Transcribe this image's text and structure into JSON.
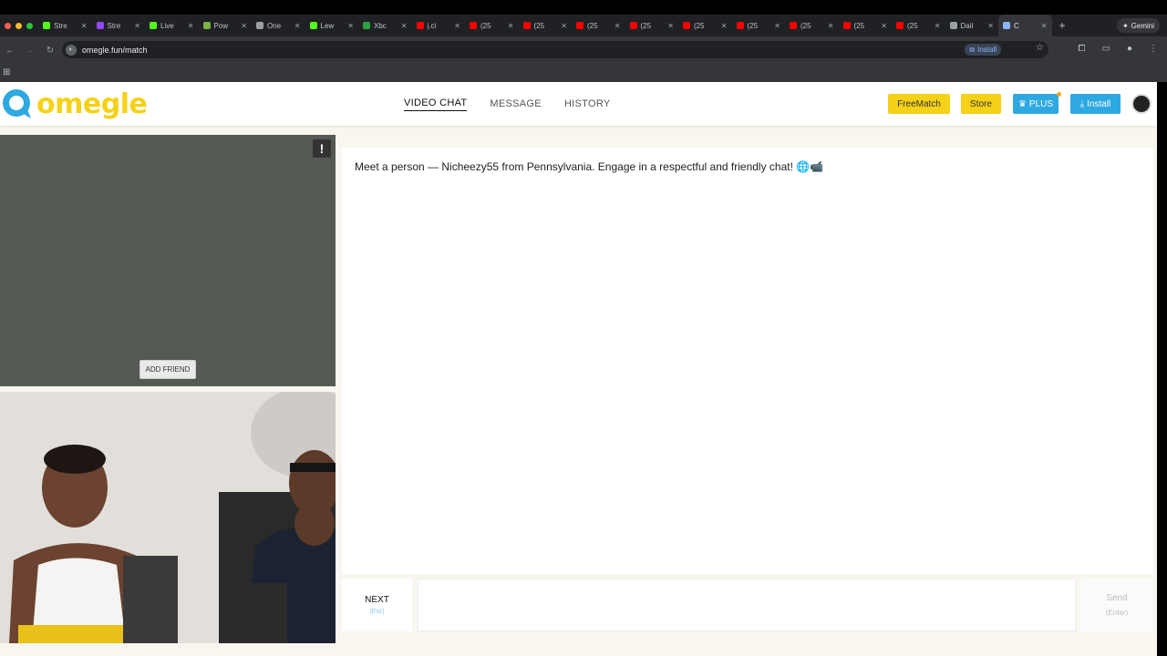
{
  "browser": {
    "tabs": [
      {
        "label": "Stre",
        "icon": "kick-icon",
        "color": "#53fc18"
      },
      {
        "label": "Stre",
        "icon": "twitch-icon",
        "color": "#9146ff"
      },
      {
        "label": "Live",
        "icon": "play-icon",
        "color": "#53fc18"
      },
      {
        "label": "Pow",
        "icon": "leaf-icon",
        "color": "#7cb342"
      },
      {
        "label": "One",
        "icon": "globe-icon",
        "color": "#9aa0a6"
      },
      {
        "label": "Lew",
        "icon": "play-icon",
        "color": "#53fc18"
      },
      {
        "label": "Xbc",
        "icon": "xbox-icon",
        "color": "#2ca243"
      },
      {
        "label": "j.ci",
        "icon": "youtube-icon",
        "color": "#ff0000"
      },
      {
        "label": "(25",
        "icon": "youtube-icon",
        "color": "#ff0000"
      },
      {
        "label": "(25",
        "icon": "youtube-icon",
        "color": "#ff0000"
      },
      {
        "label": "(25",
        "icon": "youtube-icon",
        "color": "#ff0000"
      },
      {
        "label": "(25",
        "icon": "youtube-icon",
        "color": "#ff0000"
      },
      {
        "label": "(25",
        "icon": "youtube-icon",
        "color": "#ff0000"
      },
      {
        "label": "(25",
        "icon": "youtube-icon",
        "color": "#ff0000"
      },
      {
        "label": "(25",
        "icon": "youtube-icon",
        "color": "#ff0000"
      },
      {
        "label": "(25",
        "icon": "youtube-icon",
        "color": "#ff0000"
      },
      {
        "label": "(25",
        "icon": "youtube-icon",
        "color": "#ff0000"
      },
      {
        "label": "Dail",
        "icon": "x-icon",
        "color": "#9aa0a6"
      },
      {
        "label": "C",
        "icon": "omegle-icon",
        "color": "#8ab4f8",
        "active": true
      }
    ],
    "new_tab": "+",
    "gemini_label": "Gemini",
    "url": "omegle.fun/match",
    "install_label": "Install"
  },
  "site": {
    "logo_text": "omegle",
    "nav": [
      {
        "label": "VIDEO CHAT",
        "active": true
      },
      {
        "label": "MESSAGE",
        "active": false
      },
      {
        "label": "HISTORY",
        "active": false
      }
    ],
    "buttons": {
      "freematch": "FreeMatch",
      "store": "Store",
      "plus": "PLUS",
      "install": "Install"
    },
    "colors": {
      "brand_yellow": "#f5d117",
      "brand_blue": "#2ea8e0"
    }
  },
  "video": {
    "report_label": "!",
    "add_friend": "ADD FRIEND"
  },
  "chat": {
    "message": "Meet a person — Nicheezy55 from Pennsylvania. Engage in a respectful and friendly chat! 🌐📹"
  },
  "controls": {
    "next_label": "NEXT",
    "next_hint": "(Esc)",
    "input_value": "",
    "send_label": "Send",
    "send_hint": "(Enter)"
  }
}
